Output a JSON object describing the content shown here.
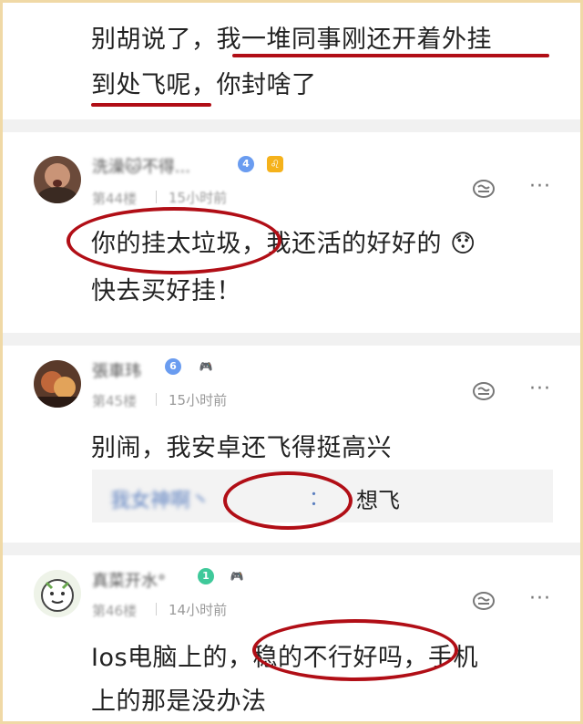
{
  "top_comment": {
    "line1_a": "别胡说了，",
    "line1_b": "我一堆同事刚还开着外挂",
    "line2_a": "到处飞呢",
    "line2_b": "，你封啥了"
  },
  "comments": [
    {
      "username": "洗澡🐱不得...",
      "level": "4",
      "floor": "第44楼",
      "time": "15小时前",
      "lines": [
        "你的挂太垃圾，我还活的好好的 😯",
        "快去买好挂！"
      ]
    },
    {
      "username": "張車玮",
      "level": "6",
      "floor": "第45楼",
      "time": "15小时前",
      "lines": [
        "别闹，我安卓还飞得挺高兴"
      ],
      "reply": {
        "name": "我女神啊丶",
        "sep": "：",
        "text": "想飞"
      }
    },
    {
      "username": "真菜开水°",
      "level": "1",
      "floor": "第46楼",
      "time": "14小时前",
      "lines": [
        "Ios电脑上的，稳的不行好吗，手机",
        "上的那是没办法"
      ]
    }
  ],
  "icons": {
    "vip": "vip-icon",
    "gamepad": "gamepad-icon",
    "reply": "reply-icon",
    "more": "more-icon"
  },
  "colors": {
    "annotation_red": "#b10e16",
    "level_blue": "#6a9cf0",
    "level_green": "#3fc99a",
    "frame": "#f0d9a6"
  },
  "more_label": "···"
}
